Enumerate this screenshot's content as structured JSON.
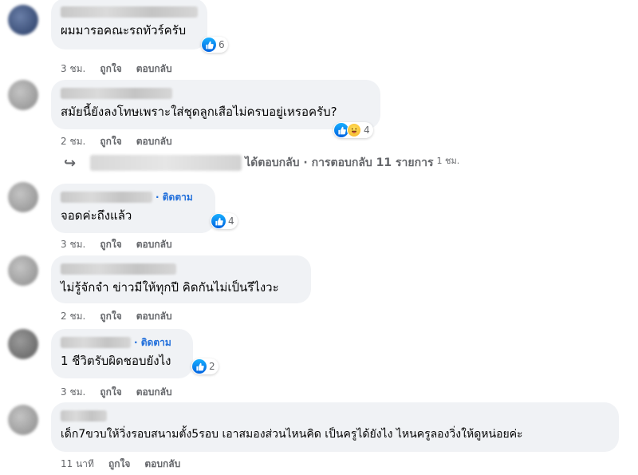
{
  "comments": [
    {
      "text": "ผมมารอคณะรถทัวร์ครับ",
      "reactions_count": "6",
      "time": "3 ชม.",
      "like_label": "ถูกใจ",
      "reply_label": "ตอบกลับ",
      "follow": ""
    },
    {
      "text": "สมัยนี้ยังลงโทษเพราะใส่ชุดลูกเสือไม่ครบอยู่เหรอครับ?",
      "reactions_count": "4",
      "time": "2 ชม.",
      "like_label": "ถูกใจ",
      "reply_label": "ตอบกลับ",
      "follow": ""
    },
    {
      "text": "จอดค่ะถึงแล้ว",
      "reactions_count": "4",
      "time": "3 ชม.",
      "like_label": "ถูกใจ",
      "reply_label": "ตอบกลับ",
      "follow": "· ติดตาม"
    },
    {
      "text": "ไม่รู้จักจำ ข่าวมีให้ทุกปี คิดกันไม่เป็นรึไงวะ",
      "reactions_count": "",
      "time": "2 ชม.",
      "like_label": "ถูกใจ",
      "reply_label": "ตอบกลับ",
      "follow": ""
    },
    {
      "text": "1 ชีวิตรับผิดชอบยังไง",
      "reactions_count": "2",
      "time": "3 ชม.",
      "like_label": "ถูกใจ",
      "reply_label": "ตอบกลับ",
      "follow": "· ติดตาม"
    },
    {
      "text": "เด็ก7ขวบให้วิ่งรอบสนามตั้ง5รอบ เอาสมองส่วนไหนคิด เป็นครูได้ยังไง ไหนครูลองวิ่งให้ดูหน่อยค่ะ",
      "reactions_count": "",
      "time": "11 นาที",
      "like_label": "ถูกใจ",
      "reply_label": "ตอบกลับ",
      "follow": ""
    }
  ],
  "reply_summary": {
    "text": "ได้ตอบกลับ · การตอบกลับ 11 รายการ",
    "time": "1 ชม."
  },
  "colors": {
    "bubble": "#f0f2f5",
    "like_blue": "#1877f2",
    "secondary_text": "#65676b",
    "follow_link": "#216fdb"
  },
  "icons": [
    "like-icon",
    "haha-icon",
    "reply-arrow-icon"
  ]
}
